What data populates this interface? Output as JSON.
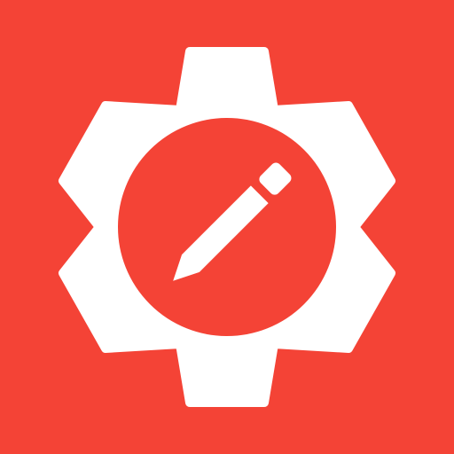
{
  "app_icon": {
    "icon_name": "settings-edit-icon",
    "parts": [
      "gear-icon",
      "pencil-icon"
    ],
    "colors": {
      "background": "#F44336",
      "foreground": "#FFFFFF"
    }
  }
}
